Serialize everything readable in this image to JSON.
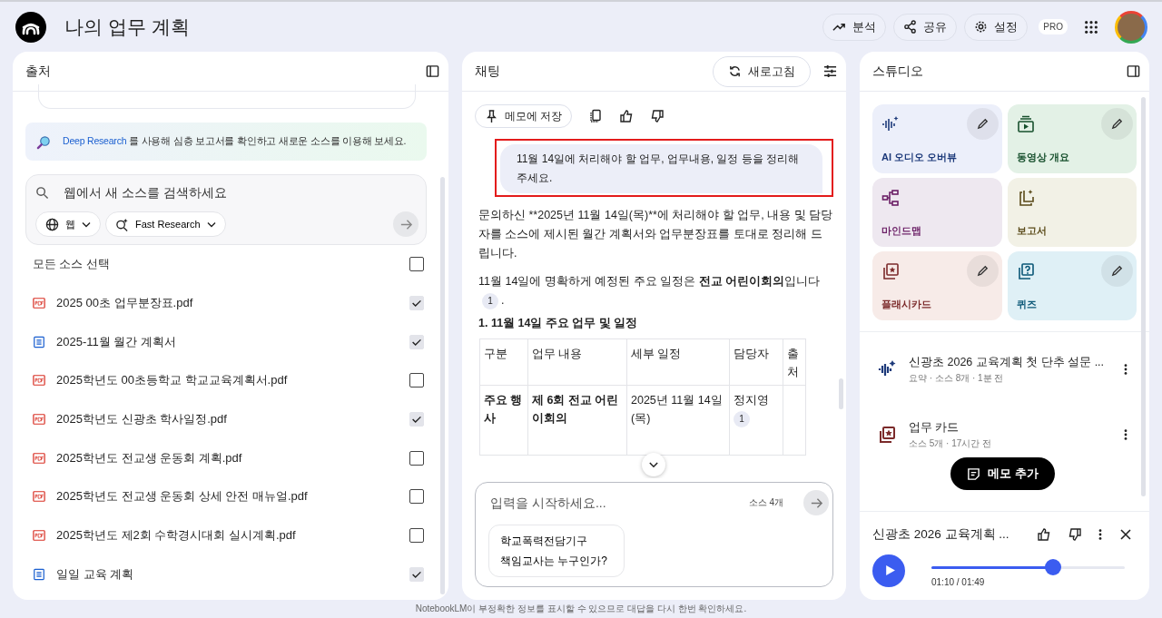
{
  "header": {
    "title": "나의 업무 계획",
    "actions": [
      {
        "kind": "analytics",
        "label": "분석"
      },
      {
        "kind": "share",
        "label": "공유"
      },
      {
        "kind": "settings",
        "label": "설정"
      }
    ],
    "badge": "PRO"
  },
  "sources": {
    "title": "출처",
    "banner": {
      "link": "Deep Research",
      "text": " 를 사용해 심층 보고서를 확인하고 새로운 소스를 이용해 보세요."
    },
    "search": {
      "placeholder": "웹에서 새 소스를 검색하세요",
      "chips": [
        {
          "kind": "web",
          "label": "웹"
        },
        {
          "kind": "research",
          "label": "Fast Research"
        }
      ]
    },
    "select_all": {
      "label": "모든 소스 선택",
      "checked": false
    },
    "items": [
      {
        "kind": "pdf",
        "name": "2025 00초 업무분장표.pdf",
        "checked": true
      },
      {
        "kind": "doc",
        "name": "2025-11월 월간 계획서",
        "checked": true
      },
      {
        "kind": "pdf",
        "name": "2025학년도 00초등학교 학교교육계획서.pdf",
        "checked": false
      },
      {
        "kind": "pdf",
        "name": "2025학년도 신광초 학사일정.pdf",
        "checked": true
      },
      {
        "kind": "pdf",
        "name": "2025학년도 전교생 운동회 계획.pdf",
        "checked": false
      },
      {
        "kind": "pdf",
        "name": "2025학년도 전교생 운동회 상세 안전 매뉴얼.pdf",
        "checked": false
      },
      {
        "kind": "pdf",
        "name": "2025학년도 제2회 수학경시대회 실시계획.pdf",
        "checked": false
      },
      {
        "kind": "doc",
        "name": "일일 교육 계획",
        "checked": true
      }
    ]
  },
  "chat": {
    "title": "채팅",
    "refresh": "새로고침",
    "save_note": "메모에 저장",
    "user_message": "11월 14일에 처리해야 할 업무, 업무내용, 일정 등을 정리해주세요.",
    "answer_intro": "문의하신 **2025년 11월 14일(목)**에 처리해야 할 업무, 내용 및 담당자를 소스에 제시된 월간 계획서와 업무분장표를 토대로 정리해 드립니다.",
    "answer_line": "11월 14일에 명확하게 예정된 주요 일정은 **전교 어린이회의**입니다",
    "answer_line_citation": "1",
    "answer_line_end": ".",
    "heading": "1. 11월 14일 주요 업무 및 일정",
    "table": {
      "columns": [
        "구분",
        "업무 내용",
        "세부 일정",
        "담당자",
        "출처"
      ],
      "rows": [
        {
          "category": "주요 행사",
          "task": "제 6회 전교 어린이회의",
          "schedule": "2025년 11월 14일 (목)",
          "owner": "정지영",
          "citation": "1"
        }
      ]
    },
    "composer": {
      "placeholder": "입력을 시작하세요...",
      "source_count": "소스 4개",
      "suggestion": "학교폭력전담기구 책임교사는 누구인가?"
    }
  },
  "studio": {
    "title": "스튜디오",
    "tiles": [
      {
        "kind": "audio",
        "label": "AI 오디오 오버뷰",
        "editable": true,
        "color": "#1d3a7a"
      },
      {
        "kind": "video",
        "label": "동영상 개요",
        "editable": true,
        "color": "#17502d"
      },
      {
        "kind": "mindmap",
        "label": "마인드맵",
        "editable": false,
        "color": "#6b1f66"
      },
      {
        "kind": "report",
        "label": "보고서",
        "editable": false,
        "color": "#5a4a19"
      },
      {
        "kind": "flashcard",
        "label": "플래시카드",
        "editable": true,
        "color": "#7b2a2a"
      },
      {
        "kind": "quiz",
        "label": "퀴즈",
        "editable": true,
        "color": "#0b5777"
      }
    ],
    "notes": [
      {
        "kind": "audio",
        "title": "신광초 2026 교육계획 첫 단추 설문 ...",
        "meta": "요약 · 소스 8개 · 1분 전",
        "color": "#1d3a7a"
      },
      {
        "kind": "flashcard",
        "title": "업무 카드",
        "meta": "소스 5개 · 17시간 전",
        "color": "#7b2a2a"
      }
    ],
    "add_note": "메모 추가",
    "player": {
      "title": "신광초 2026 교육계획 ...",
      "time": "01:10 / 01:49",
      "level": 0.63
    }
  },
  "footer": "NotebookLM이 부정확한 정보를 표시할 수 있으므로 대답을 다시 한번 확인하세요."
}
